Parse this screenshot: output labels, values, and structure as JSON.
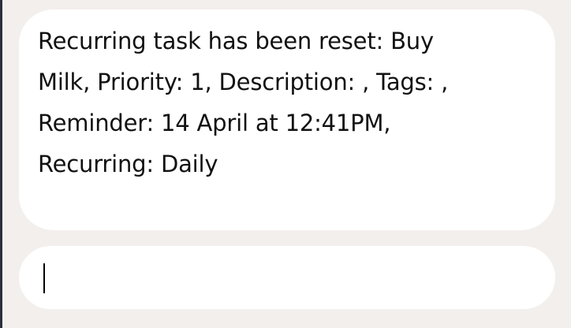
{
  "chat": {
    "message_lines": [
      "Recurring task has been reset: Buy",
      "Milk, Priority: 1, Description: , Tags: ,",
      "Reminder: 14 April at 12:41PM,",
      "Recurring: Daily"
    ]
  },
  "input": {
    "value": "",
    "placeholder": ""
  }
}
